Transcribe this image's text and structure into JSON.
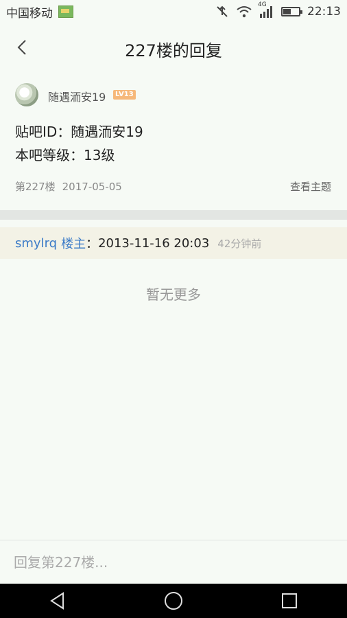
{
  "status_bar": {
    "carrier": "中国移动",
    "network": "4G",
    "time": "22:13"
  },
  "header": {
    "title": "227楼的回复"
  },
  "post": {
    "username": "随遇洏安19",
    "level_badge": "LV13",
    "line1": "贴吧ID：随遇洏安19",
    "line2": "本吧等级：13级",
    "floor": "第227楼",
    "date": "2017-05-05",
    "view_topic": "查看主题"
  },
  "reply": {
    "user": "smylrq",
    "role": "楼主",
    "colon": "：",
    "text": "2013-11-16 20:03",
    "time_ago": "42分钟前"
  },
  "no_more": "暂无更多",
  "input": {
    "placeholder": "回复第227楼..."
  },
  "icons": {
    "back": "chevron-left-icon",
    "sys_back": "triangle-back-icon",
    "sys_home": "circle-home-icon",
    "sys_recents": "square-recents-icon"
  }
}
